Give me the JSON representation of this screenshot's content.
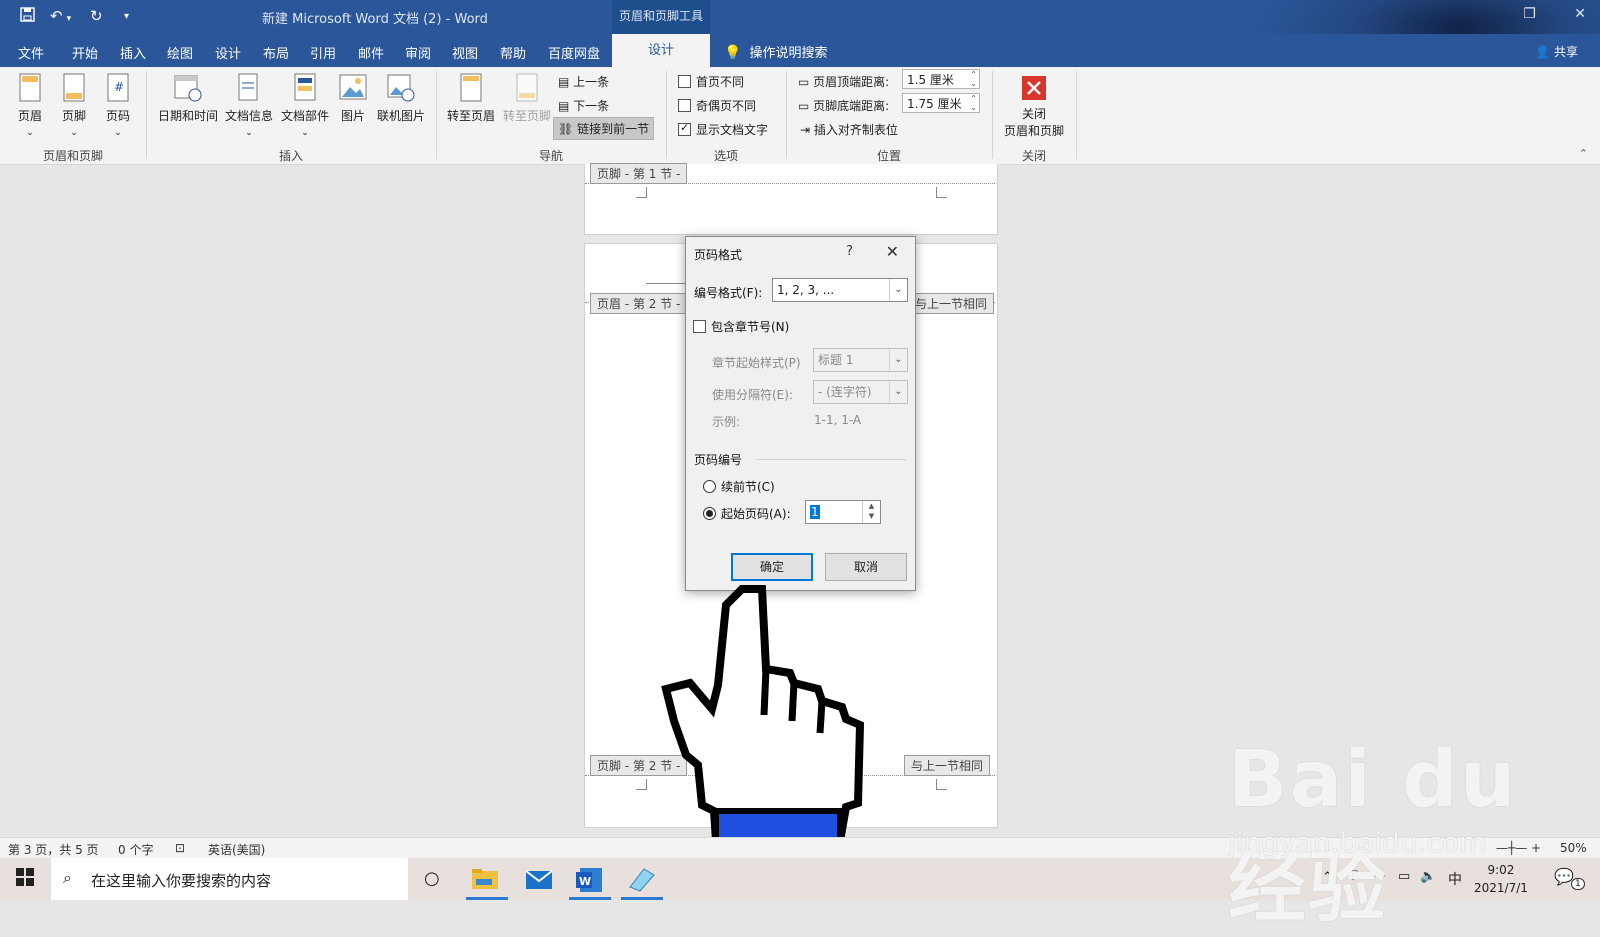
{
  "title_bar": {
    "document_title": "新建 Microsoft Word 文档 (2)  -  Word",
    "contextual_tab": "页眉和页脚工具"
  },
  "menu": {
    "tabs": [
      "文件",
      "开始",
      "插入",
      "绘图",
      "设计",
      "布局",
      "引用",
      "邮件",
      "审阅",
      "视图",
      "帮助",
      "百度网盘"
    ],
    "active_tab": "设计",
    "tell_me": "操作说明搜索",
    "share": "共享"
  },
  "ribbon": {
    "header_footer": {
      "header": "页眉",
      "footer": "页脚",
      "page_number": "页码",
      "group": "页眉和页脚"
    },
    "insert": {
      "date_time": "日期和时间",
      "doc_info": "文档信息",
      "quick_parts": "文档部件",
      "pictures": "图片",
      "online_pictures": "联机图片",
      "group": "插入"
    },
    "navigation": {
      "goto_header": "转至页眉",
      "goto_footer": "转至页脚",
      "previous": "上一条",
      "next": "下一条",
      "link_previous": "链接到前一节",
      "group": "导航"
    },
    "options": {
      "diff_first": "首页不同",
      "diff_odd_even": "奇偶页不同",
      "show_text": "显示文档文字",
      "group": "选项"
    },
    "position": {
      "header_top_label": "页眉顶端距离:",
      "header_top_value": "1.5 厘米",
      "footer_bottom_label": "页脚底端距离:",
      "footer_bottom_value": "1.75 厘米",
      "insert_tab": "插入对齐制表位",
      "group": "位置"
    },
    "close": {
      "label_line1": "关闭",
      "label_line2": "页眉和页脚",
      "group": "关闭"
    }
  },
  "document": {
    "footer_section1": "页脚 - 第 1 节 -",
    "header_section2": "页眉 - 第 2 节 -",
    "same_as_prev_header": "与上一节相同",
    "footer_section2": "页脚 - 第 2 节 -",
    "same_as_prev_footer": "与上一节相同"
  },
  "dialog": {
    "title": "页码格式",
    "help": "?",
    "number_format_label": "编号格式(F):",
    "number_format_value": "1, 2, 3, ...",
    "include_chapter": "包含章节号(N)",
    "chapter_style_label": "章节起始样式(P)",
    "chapter_style_value": "标题 1",
    "separator_label": "使用分隔符(E):",
    "separator_value": "-  (连字符)",
    "example_label": "示例:",
    "example_value": "1-1, 1-A",
    "numbering_group": "页码编号",
    "continue_prev": "续前节(C)",
    "start_at": "起始页码(A):",
    "start_at_value": "1",
    "ok": "确定",
    "cancel": "取消"
  },
  "status_bar": {
    "page": "第 3 页，共 5 页",
    "words": "0 个字",
    "language": "英语(美国)",
    "zoom": "50%"
  },
  "taskbar": {
    "search_placeholder": "在这里输入你要搜索的内容",
    "ime": "中",
    "time": "9:02",
    "date": "2021/7/1",
    "notifications": "1"
  },
  "watermark": {
    "line1": "Bai du 经验",
    "line2": "jingyan.baidu.com"
  },
  "colors": {
    "word_blue": "#2b579a",
    "ribbon_bg": "#f3f3f3",
    "close_red": "#d9362b",
    "dialog_bg": "#f0f0f0",
    "focus_blue": "#0078d7"
  }
}
